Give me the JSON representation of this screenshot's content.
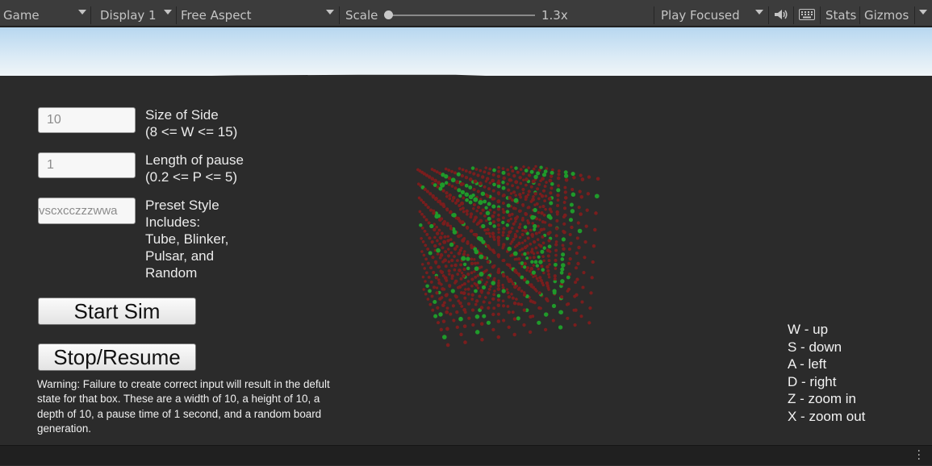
{
  "toolbar": {
    "game_label": "Game",
    "display_label": "Display 1",
    "aspect_label": "Free Aspect",
    "scale_label": "Scale",
    "scale_value": "1.3x",
    "scale_fraction": 0.0,
    "play_mode_label": "Play Focused",
    "stats_label": "Stats",
    "gizmos_label": "Gizmos",
    "icons": [
      "volume-icon",
      "keyboard-icon",
      "chevron-down-icon"
    ]
  },
  "form": {
    "side_value": "10",
    "side_label": "Size of Side",
    "side_range": "(8 <= W <= 15)",
    "pause_value": "1",
    "pause_label": "Length of pause",
    "pause_range": "(0.2 <= P <= 5)",
    "preset_value": "vscxcczzzwwa",
    "preset_lines": [
      "Preset Style",
      "Includes:",
      "Tube, Blinker,",
      "Pulsar, and",
      "Random"
    ],
    "start_button": "Start Sim",
    "stop_button": "Stop/Resume",
    "warning": "Warning: Failure to create correct input will result in the defult state for that box. These are a width of 10, a height of 10, a depth of 10, a pause time of 1 second, and a random board generation."
  },
  "controls": [
    "W - up",
    "S - down",
    "A - left",
    "D - right",
    "Z - zoom in",
    "X - zoom out"
  ],
  "colors": {
    "dead_cell": "#7a1d1d",
    "live_cell": "#1f9a2a",
    "background": "#2b2b2b",
    "toolbar": "#3c3c3c"
  }
}
